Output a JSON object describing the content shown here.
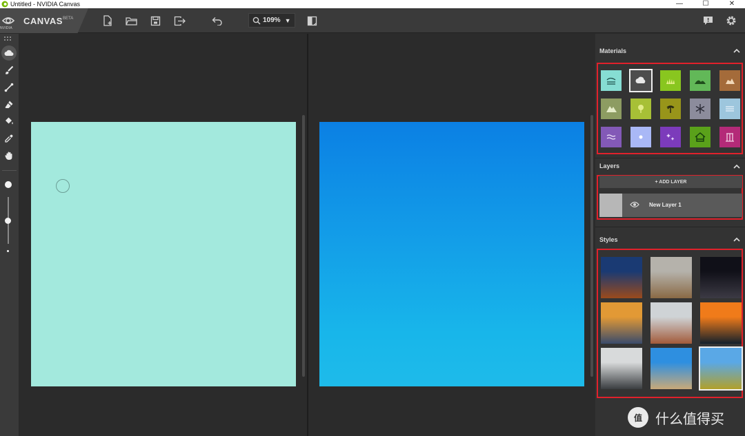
{
  "window": {
    "title": "Untitled - NVIDIA Canvas",
    "controls": [
      "—",
      "☐",
      "✕"
    ]
  },
  "brand": {
    "vendor": "NVIDIA",
    "product": "CANVAS",
    "badge": "BETA"
  },
  "toolbar": {
    "icons": [
      "new-file-icon",
      "open-folder-icon",
      "save-icon",
      "export-icon",
      "undo-icon",
      "zoom-icon",
      "split-view-icon",
      "feedback-icon",
      "settings-gear-icon"
    ],
    "zoom_value": "109%"
  },
  "tools": [
    "material-brush-icon",
    "paintbrush-icon",
    "line-icon",
    "eraser-icon",
    "fill-bucket-icon",
    "eyedropper-icon",
    "hand-pan-icon"
  ],
  "brush_size_level": 0.5,
  "canvas": {
    "segmentation_color": "#a3e9dd",
    "output_top_color": "#0b80e4",
    "output_bottom_color": "#1ebbea"
  },
  "panel": {
    "materials": {
      "title": "Materials",
      "items": [
        {
          "name": "sky-water-icon",
          "color": "#86ddd3"
        },
        {
          "name": "cloud-icon",
          "color": "#4d4d4d"
        },
        {
          "name": "grass-icon",
          "color": "#89c61f"
        },
        {
          "name": "hill-icon",
          "color": "#62b858"
        },
        {
          "name": "rock-icon",
          "color": "#a46b3a"
        },
        {
          "name": "mountain-icon",
          "color": "#8d9c62"
        },
        {
          "name": "tree-icon",
          "color": "#a7c036"
        },
        {
          "name": "palm-icon",
          "color": "#98951a"
        },
        {
          "name": "snow-icon",
          "color": "#8c8c9c"
        },
        {
          "name": "fog-icon",
          "color": "#9dc6dd"
        },
        {
          "name": "water-waves-icon",
          "color": "#8359b7"
        },
        {
          "name": "sun-icon",
          "color": "#a9b8f6"
        },
        {
          "name": "sparkles-icon",
          "color": "#7c3bbb"
        },
        {
          "name": "house-icon",
          "color": "#5aa11a"
        },
        {
          "name": "building-icon",
          "color": "#b42a78"
        }
      ]
    },
    "layers": {
      "title": "Layers",
      "add_label": "+ ADD LAYER",
      "items": [
        {
          "name": "New Layer 1"
        }
      ]
    },
    "styles": {
      "title": "Styles",
      "items": [
        {
          "name": "desert-mesa-thumbnail",
          "top": "#1a3a73",
          "bottom": "#9b4a1c"
        },
        {
          "name": "cloudy-peaks-thumbnail",
          "top": "#b5b2ab",
          "bottom": "#8a6a45"
        },
        {
          "name": "night-stars-thumbnail",
          "top": "#101018",
          "bottom": "#3c3a44"
        },
        {
          "name": "sunset-mist-thumbnail",
          "top": "#e29935",
          "bottom": "#3a4b6b"
        },
        {
          "name": "rocky-peak-thumbnail",
          "top": "#cfd3d6",
          "bottom": "#a25a3a"
        },
        {
          "name": "ocean-sunset-thumbnail",
          "top": "#f07b1a",
          "bottom": "#13202b"
        },
        {
          "name": "misty-forest-thumbnail",
          "top": "#d8dadb",
          "bottom": "#3a3d40"
        },
        {
          "name": "beach-sky-thumbnail",
          "top": "#2e8fe0",
          "bottom": "#c9a978"
        },
        {
          "name": "mountain-lake-thumbnail",
          "top": "#5aa8e6",
          "bottom": "#b2a02a"
        }
      ]
    }
  },
  "watermark": {
    "logo": "值",
    "text": "什么值得买"
  }
}
